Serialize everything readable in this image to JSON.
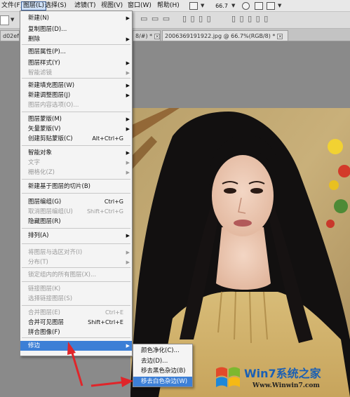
{
  "menubar": {
    "items": [
      {
        "label": "文件(F)"
      },
      {
        "label": "图层(L)"
      },
      {
        "label": "选择(S)"
      },
      {
        "label": "滤镜(T)"
      },
      {
        "label": "视图(V)"
      },
      {
        "label": "窗口(W)"
      },
      {
        "label": "帮助(H)"
      }
    ],
    "zoom": "66.7"
  },
  "tabs": [
    {
      "label": "d02ef0"
    },
    {
      "label": "8/#) *"
    },
    {
      "label": "2006369191922.jpg @ 66.7%(RGB/8) *"
    }
  ],
  "layer_menu": {
    "items": [
      {
        "label": "新建(N)",
        "arrow": true
      },
      {
        "label": "复制图层(D)..."
      },
      {
        "label": "删除",
        "arrow": true
      },
      {
        "label": "图层属性(P)..."
      },
      {
        "label": "图层样式(Y)",
        "arrow": true
      },
      {
        "label": "智能滤镜",
        "disabled": true,
        "arrow": true
      },
      {
        "label": "新建填充图层(W)",
        "arrow": true
      },
      {
        "label": "新建调整图层(J)",
        "arrow": true
      },
      {
        "label": "图层内容选项(O)...",
        "disabled": true
      },
      {
        "label": "图层蒙版(M)",
        "arrow": true
      },
      {
        "label": "矢量蒙版(V)",
        "arrow": true
      },
      {
        "label": "创建剪贴蒙版(C)",
        "shortcut": "Alt+Ctrl+G"
      },
      {
        "label": "智能对象",
        "arrow": true
      },
      {
        "label": "文字",
        "disabled": true,
        "arrow": true
      },
      {
        "label": "栅格化(Z)",
        "disabled": true,
        "arrow": true
      },
      {
        "label": "新建基于图层的切片(B)"
      },
      {
        "label": "图层编组(G)",
        "shortcut": "Ctrl+G"
      },
      {
        "label": "取消图层编组(U)",
        "shortcut": "Shift+Ctrl+G",
        "disabled": true
      },
      {
        "label": "隐藏图层(R)"
      },
      {
        "label": "排列(A)",
        "arrow": true
      },
      {
        "label": "将图层与选区对齐(I)",
        "disabled": true,
        "arrow": true
      },
      {
        "label": "分布(T)",
        "disabled": true,
        "arrow": true
      },
      {
        "label": "锁定组内的所有图层(X)...",
        "disabled": true
      },
      {
        "label": "链接图层(K)",
        "disabled": true
      },
      {
        "label": "选择链接图层(S)",
        "disabled": true
      },
      {
        "label": "合并图层(E)",
        "shortcut": "Ctrl+E",
        "disabled": true
      },
      {
        "label": "合并可见图层",
        "shortcut": "Shift+Ctrl+E"
      },
      {
        "label": "拼合图像(F)"
      },
      {
        "label": "修边",
        "arrow": true,
        "highlighted": true
      }
    ]
  },
  "matting_submenu": {
    "items": [
      {
        "label": "颜色净化(C)..."
      },
      {
        "label": "去边(D)..."
      },
      {
        "label": "移去黑色杂边(B)"
      },
      {
        "label": "移去白色杂边(W)",
        "highlighted": true
      }
    ]
  },
  "watermark": {
    "title": "Win7系统之家",
    "url": "Www.Winwin7.com"
  },
  "colors": {
    "highlight": "#3c7fd6",
    "annotation_arrow": "#e0252a",
    "menu_bg": "#f4f4f4"
  }
}
